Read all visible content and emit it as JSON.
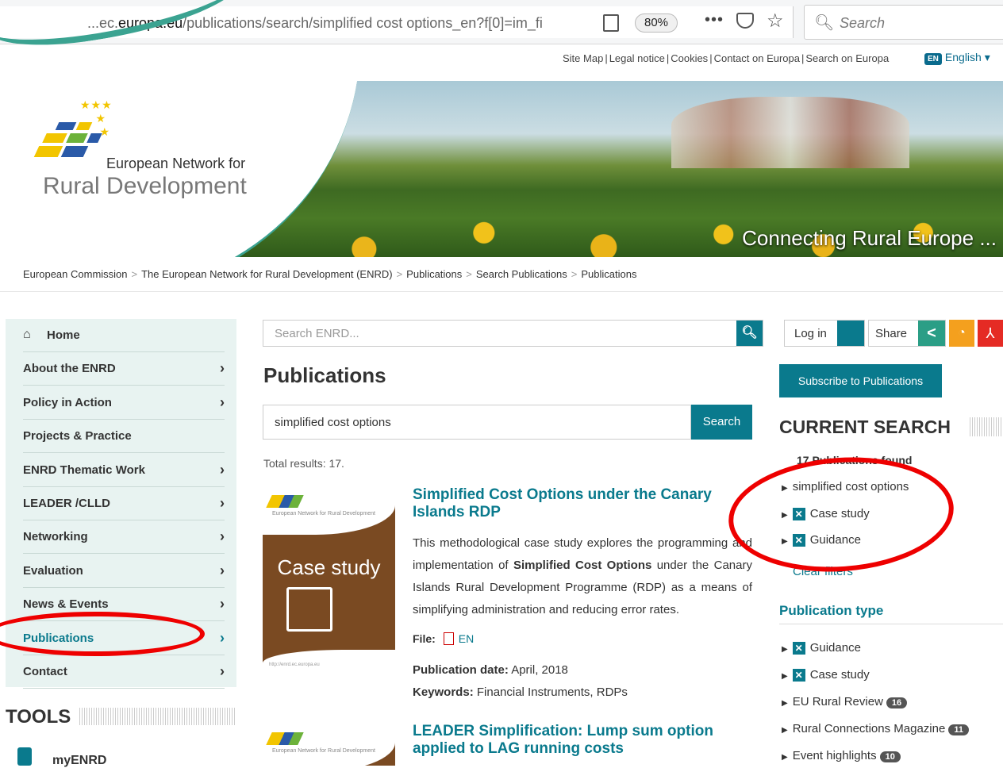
{
  "browser": {
    "url_prefix": "...ec.",
    "url_domain": "europa.eu",
    "url_path": "/publications/search/simplified cost options_en?f[0]=im_fi",
    "zoom": "80%",
    "search_placeholder": "Search"
  },
  "toplinks": [
    "Site Map",
    "Legal notice",
    "Cookies",
    "Contact on Europa",
    "Search on Europa"
  ],
  "language": {
    "code": "EN",
    "label": "English"
  },
  "banner": {
    "logo_line1": "European Network for",
    "logo_line2": "Rural Development",
    "tagline": "Connecting Rural Europe ..."
  },
  "breadcrumb": [
    "European Commission",
    "The European Network for Rural Development (ENRD)",
    "Publications",
    "Search Publications",
    "Publications"
  ],
  "sidenav": [
    {
      "label": "Home",
      "chevron": false
    },
    {
      "label": "About the ENRD",
      "chevron": true
    },
    {
      "label": "Policy in Action",
      "chevron": true
    },
    {
      "label": "Projects & Practice",
      "chevron": false
    },
    {
      "label": "ENRD Thematic Work",
      "chevron": true
    },
    {
      "label": "LEADER /CLLD",
      "chevron": true
    },
    {
      "label": "Networking",
      "chevron": true
    },
    {
      "label": "Evaluation",
      "chevron": true
    },
    {
      "label": "News & Events",
      "chevron": true
    },
    {
      "label": "Publications",
      "chevron": true,
      "active": true
    },
    {
      "label": "Contact",
      "chevron": true
    }
  ],
  "tools": {
    "title": "TOOLS",
    "item": "myENRD"
  },
  "main": {
    "search_placeholder": "Search ENRD...",
    "title": "Publications",
    "query": "simplified cost options",
    "search_button": "Search",
    "total": "Total results: 17."
  },
  "results": [
    {
      "cover_label": "Case study",
      "cover_logo_text": "European Network for Rural Development",
      "cover_url": "http://enrd.ec.europa.eu",
      "title": "Simplified Cost Options under the Canary Islands RDP",
      "desc_pre": "This methodological case study explores the programming and implementation of ",
      "desc_bold": "Simplified Cost Options",
      "desc_post": " under the Canary Islands Rural Development Programme (RDP) as a means of simplifying administration and reducing error rates.",
      "file_label": "File:",
      "file_lang": "EN",
      "date_label": "Publication date:",
      "date": "April, 2018",
      "kw_label": "Keywords:",
      "keywords": "Financial Instruments, RDPs"
    },
    {
      "cover_logo_text": "European Network for Rural Development",
      "title": "LEADER Simplification: Lump sum option applied to LAG running costs"
    }
  ],
  "right": {
    "login": "Log in",
    "share": "Share",
    "subscribe": "Subscribe to Publications",
    "current_search_title": "CURRENT SEARCH",
    "found": "17 Publications found",
    "current": [
      {
        "label": "simplified cost options",
        "x": false
      },
      {
        "label": "Case study",
        "x": true
      },
      {
        "label": "Guidance",
        "x": true
      }
    ],
    "clear": "Clear filters",
    "ptype_title": "Publication type",
    "ptypes": [
      {
        "label": "Guidance",
        "x": true,
        "count": ""
      },
      {
        "label": "Case study",
        "x": true,
        "count": ""
      },
      {
        "label": "EU Rural Review",
        "x": false,
        "count": "16"
      },
      {
        "label": "Rural Connections Magazine",
        "x": false,
        "count": "11"
      },
      {
        "label": "Event highlights",
        "x": false,
        "count": "10"
      }
    ]
  },
  "colors": {
    "accent": "#0a7a8d",
    "annotation": "#e00000",
    "sidenav_bg": "#e8f3f1"
  }
}
